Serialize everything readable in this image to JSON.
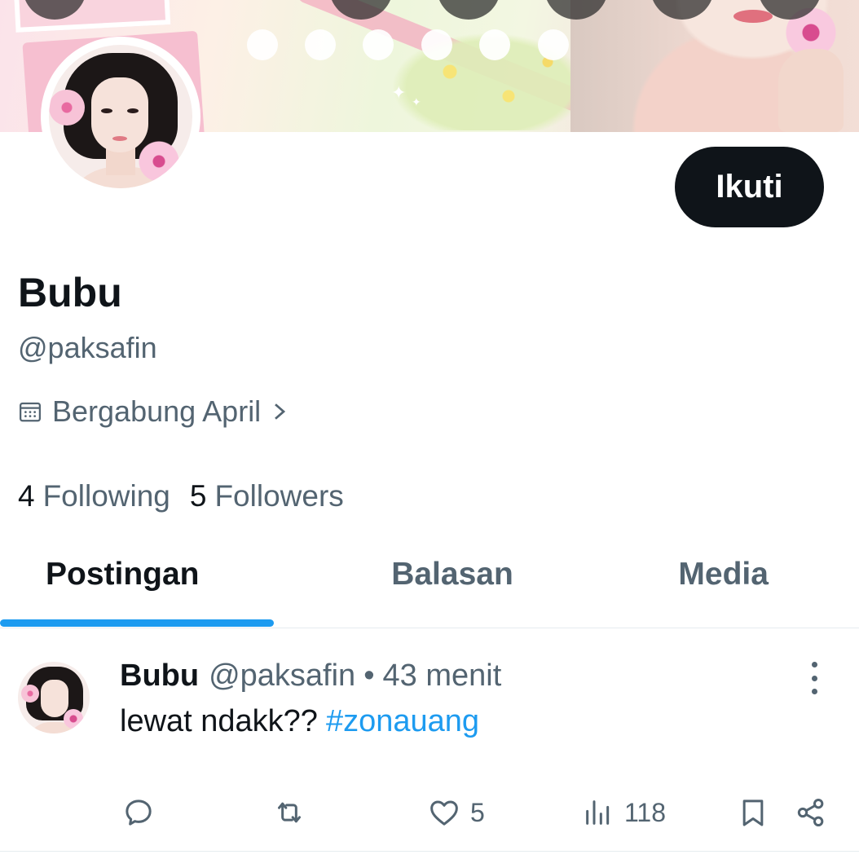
{
  "profile": {
    "display_name": "Bubu",
    "handle": "@paksafin",
    "joined": "Bergabung April",
    "follow_label": "Ikuti",
    "following_count": "4",
    "following_label": "Following",
    "followers_count": "5",
    "followers_label": "Followers"
  },
  "tabs": [
    {
      "label": "Postingan",
      "active": true
    },
    {
      "label": "Balasan",
      "active": false
    },
    {
      "label": "Media",
      "active": false
    }
  ],
  "post": {
    "name": "Bubu",
    "handle": "@paksafin",
    "separator": "•",
    "time": "43 menit",
    "text": "lewat ndakk??",
    "hashtag": "#zonauang",
    "likes": "5",
    "views": "118"
  },
  "colors": {
    "accent": "#1d9bf0",
    "text_primary": "#0f1419",
    "text_secondary": "#536471"
  },
  "icons": {
    "joined": "calendar-icon",
    "joined_arrow": "chevron-right-icon",
    "reply": "reply-icon",
    "repost": "repost-icon",
    "like": "heart-icon",
    "views": "views-icon",
    "bookmark": "bookmark-icon",
    "share": "share-icon",
    "more": "more-vertical-icon"
  }
}
